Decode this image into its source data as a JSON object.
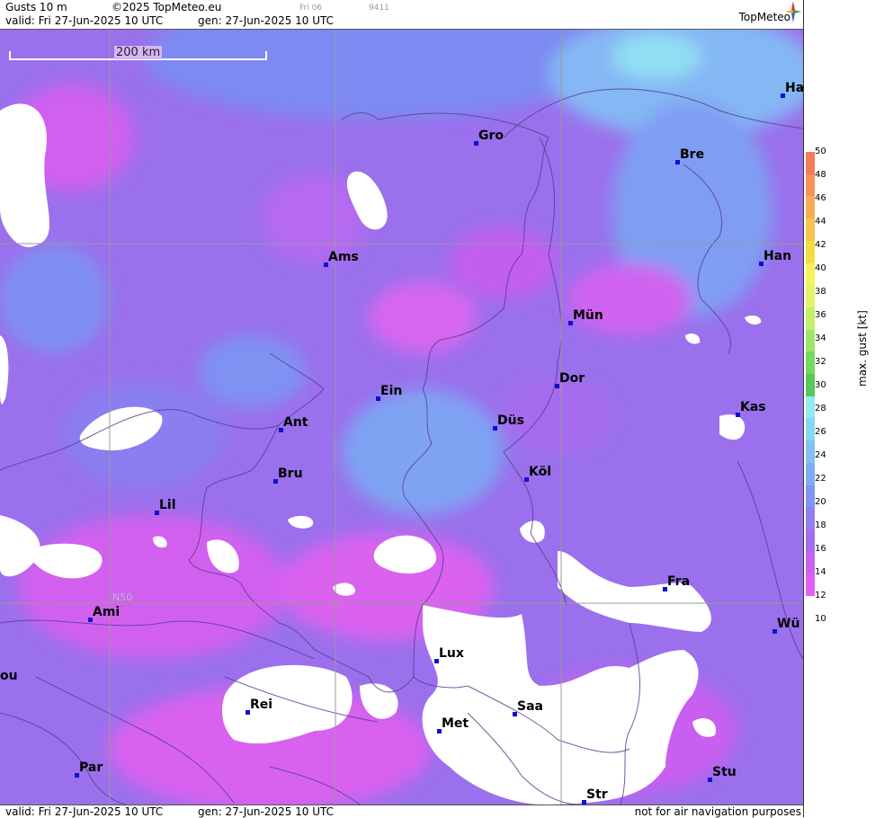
{
  "header": {
    "title": "Gusts 10 m",
    "copyright": "©2025 TopMeteo.eu",
    "valid": "valid:  Fri  27-Jun-2025  10 UTC",
    "gen": "gen: 27-Jun-2025 10 UTC",
    "small_a": "Fri 06",
    "small_b": "9411",
    "brand": "TopMeteo"
  },
  "map": {
    "scale_label": "200 km",
    "lat_label": "N50",
    "cities": [
      {
        "label": "Gro"
      },
      {
        "label": "Bre"
      },
      {
        "label": "Ha"
      },
      {
        "label": "Ams"
      },
      {
        "label": "Han"
      },
      {
        "label": "Mün"
      },
      {
        "label": "Ein"
      },
      {
        "label": "Dor"
      },
      {
        "label": "Ant"
      },
      {
        "label": "Düs"
      },
      {
        "label": "Kas"
      },
      {
        "label": "Bru"
      },
      {
        "label": "Köl"
      },
      {
        "label": "Lil"
      },
      {
        "label": "Fra"
      },
      {
        "label": "Ami"
      },
      {
        "label": "Wü"
      },
      {
        "label": "Lux"
      },
      {
        "label": "ou"
      },
      {
        "label": "Rei"
      },
      {
        "label": "Saa"
      },
      {
        "label": "Met"
      },
      {
        "label": "Par"
      },
      {
        "label": "Stu"
      },
      {
        "label": "Str"
      }
    ]
  },
  "footer": {
    "valid": "valid:  Fri  27-Jun-2025  10 UTC",
    "gen": "gen: 27-Jun-2025 10 UTC",
    "note": "not for air navigation purposes"
  },
  "legend": {
    "title": "max. gust [kt]",
    "ticks": [
      "50",
      "48",
      "46",
      "44",
      "42",
      "40",
      "38",
      "36",
      "34",
      "32",
      "30",
      "28",
      "26",
      "24",
      "22",
      "20",
      "18",
      "16",
      "14",
      "12",
      "10"
    ],
    "colors": [
      "#f77a5a",
      "#f9935a",
      "#f8ab55",
      "#f6c44a",
      "#f3dd3e",
      "#f5f25a",
      "#e6f36a",
      "#c5ee6a",
      "#9fe46a",
      "#76d85f",
      "#58c95a",
      "#95e9f2",
      "#84d8f2",
      "#80c3f3",
      "#7fadf3",
      "#7f96f2",
      "#8f7ff0",
      "#a46cf1",
      "#c963ef",
      "#e45ff0"
    ]
  }
}
